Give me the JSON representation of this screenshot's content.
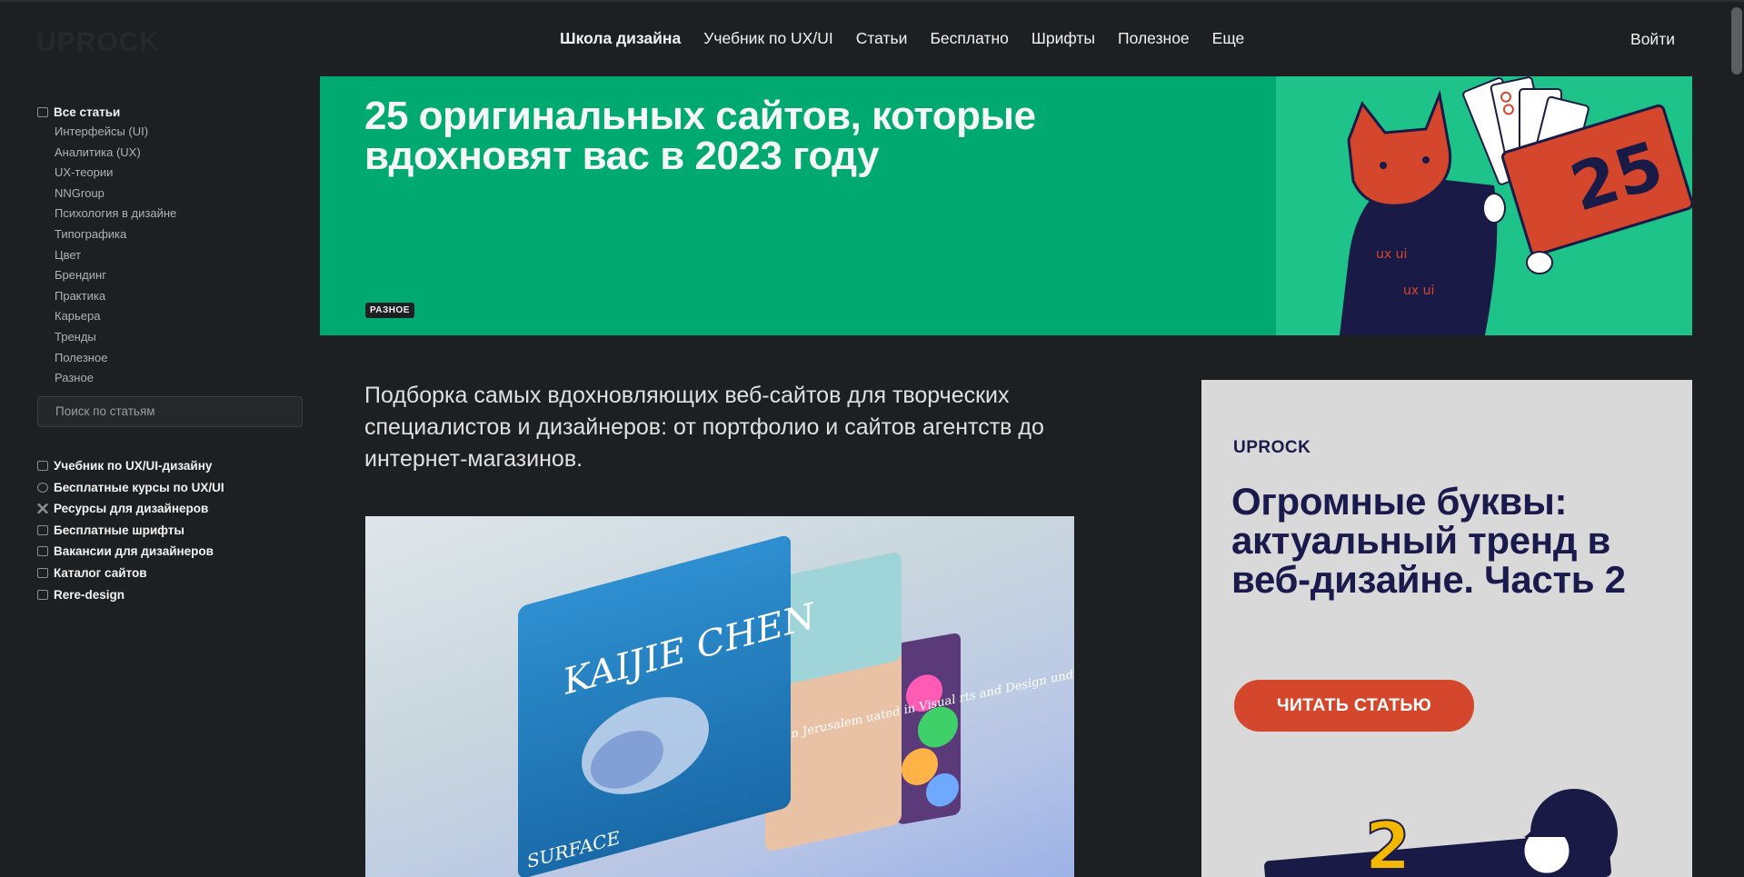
{
  "header": {
    "logo": "UPROCK",
    "nav": [
      "Школа дизайна",
      "Учебник по UX/UI",
      "Статьи",
      "Бесплатно",
      "Шрифты",
      "Полезное",
      "Еще"
    ],
    "login": "Войти"
  },
  "sidebar": {
    "all_articles": "Все статьи",
    "categories": [
      "Интерфейсы (UI)",
      "Аналитика (UX)",
      "UX-теории",
      "NNGroup",
      "Психология в дизайне",
      "Типографика",
      "Цвет",
      "Брендинг",
      "Практика",
      "Карьера",
      "Тренды",
      "Полезное",
      "Разное"
    ],
    "search_placeholder": "Поиск по статьям",
    "links": [
      "Учебник по UX/UI-дизайну",
      "Бесплатные курсы по UX/UI",
      "Ресурсы для дизайнеров",
      "Бесплатные шрифты",
      "Вакансии для дизайнеров",
      "Каталог сайтов",
      "Rere-design"
    ]
  },
  "hero": {
    "title": "25 оригинальных сайтов, которые вдохновят вас в 2023 году",
    "tag": "РАЗНОЕ",
    "badge_number": "25",
    "shirt_text": "ux ui"
  },
  "article": {
    "lead": "Подборка самых вдохновляющих веб-сайтов для творческих специалистов и дизайнеров: от портфолио и сайтов агентств до интернет-магазинов.",
    "image_text": "KAIJIE CHEN",
    "image_side_text": "d in Jerusalem uated in Visual rts and Design und Academy",
    "image_corner_text": "SURFACE"
  },
  "promo": {
    "logo": "UPROCK",
    "title": "Огромные буквы: актуальный тренд в веб-дизайне. Часть 2",
    "button": "ЧИТАТЬ СТАТЬЮ",
    "art_number": "2"
  },
  "colors": {
    "background": "#1d2022",
    "hero_green": "#00a96f",
    "promo_bg": "#d9d9d9",
    "promo_title": "#1b1a4d",
    "accent_red": "#d4472d"
  }
}
